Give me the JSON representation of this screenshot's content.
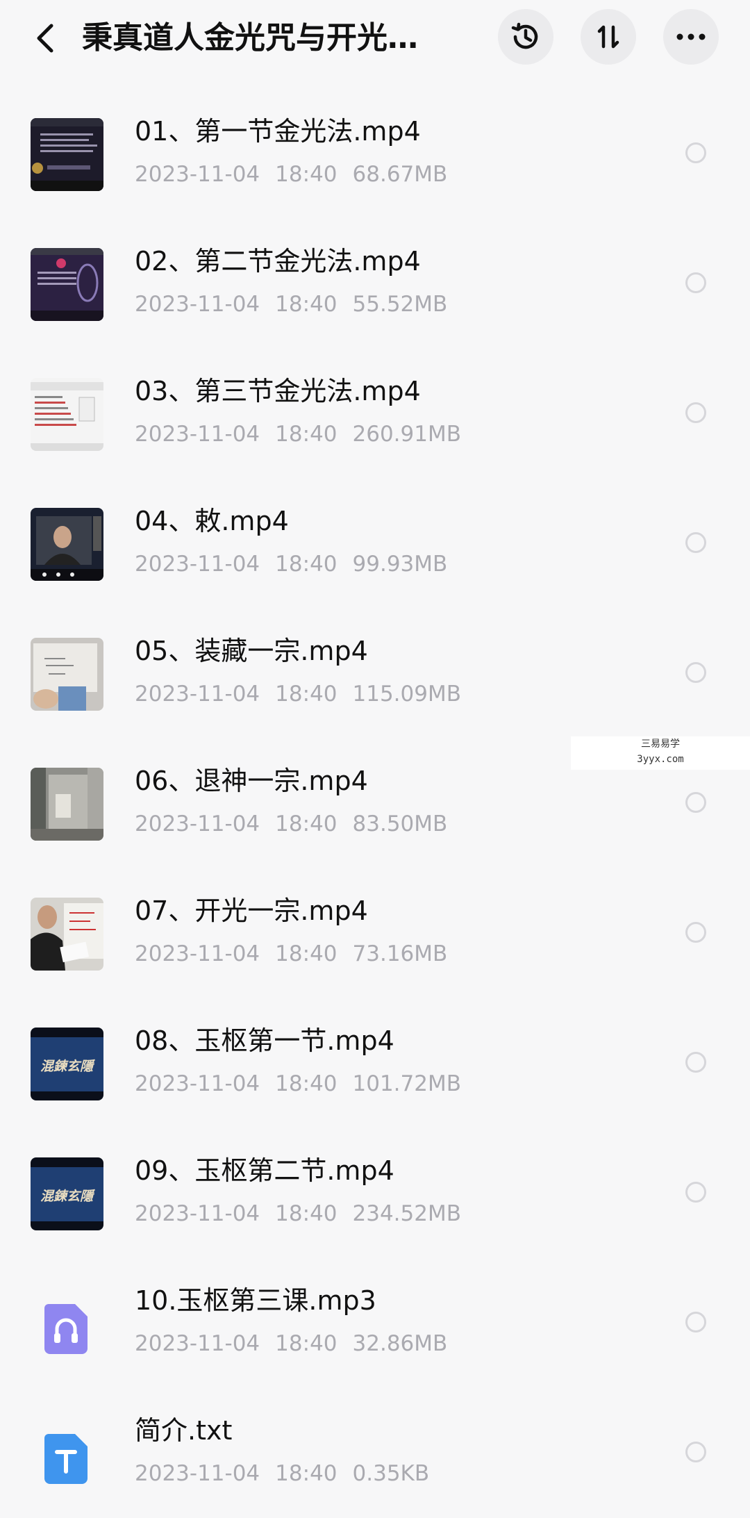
{
  "header": {
    "title": "秉真道人金光咒与开光…",
    "back_icon": "chevron-left-icon",
    "history_icon": "history-icon",
    "sort_icon": "sort-icon",
    "more_icon": "more-horizontal-icon"
  },
  "files": [
    {
      "name": "01、第一节金光法.mp4",
      "date": "2023-11-04",
      "time": "18:40",
      "size": "68.67MB",
      "thumb": "dark-slide"
    },
    {
      "name": "02、第二节金光法.mp4",
      "date": "2023-11-04",
      "time": "18:40",
      "size": "55.52MB",
      "thumb": "purple-slide"
    },
    {
      "name": "03、第三节金光法.mp4",
      "date": "2023-11-04",
      "time": "18:40",
      "size": "260.91MB",
      "thumb": "white-doc"
    },
    {
      "name": "04、敕.mp4",
      "date": "2023-11-04",
      "time": "18:40",
      "size": "99.93MB",
      "thumb": "video-call"
    },
    {
      "name": "05、装藏一宗.mp4",
      "date": "2023-11-04",
      "time": "18:40",
      "size": "115.09MB",
      "thumb": "whiteboard"
    },
    {
      "name": "06、退神一宗.mp4",
      "date": "2023-11-04",
      "time": "18:40",
      "size": "83.50MB",
      "thumb": "room"
    },
    {
      "name": "07、开光一宗.mp4",
      "date": "2023-11-04",
      "time": "18:40",
      "size": "73.16MB",
      "thumb": "person-paper"
    },
    {
      "name": "08、玉枢第一节.mp4",
      "date": "2023-11-04",
      "time": "18:40",
      "size": "101.72MB",
      "thumb": "blue-calligraphy"
    },
    {
      "name": "09、玉枢第二节.mp4",
      "date": "2023-11-04",
      "time": "18:40",
      "size": "234.52MB",
      "thumb": "blue-calligraphy"
    },
    {
      "name": "10.玉枢第三课.mp3",
      "date": "2023-11-04",
      "time": "18:40",
      "size": "32.86MB",
      "thumb": "audio-file-icon"
    },
    {
      "name": "简介.txt",
      "date": "2023-11-04",
      "time": "18:40",
      "size": "0.35KB",
      "thumb": "text-file-icon"
    }
  ],
  "calligraphy_text": "混鍊玄隱",
  "watermark": {
    "line1": "三易易学",
    "line2": "3yyx.com"
  },
  "colors": {
    "background": "#f7f7f8",
    "meta_text": "#aaaab0",
    "audio_icon": "#8f86f0",
    "text_icon": "#3f95ee"
  }
}
